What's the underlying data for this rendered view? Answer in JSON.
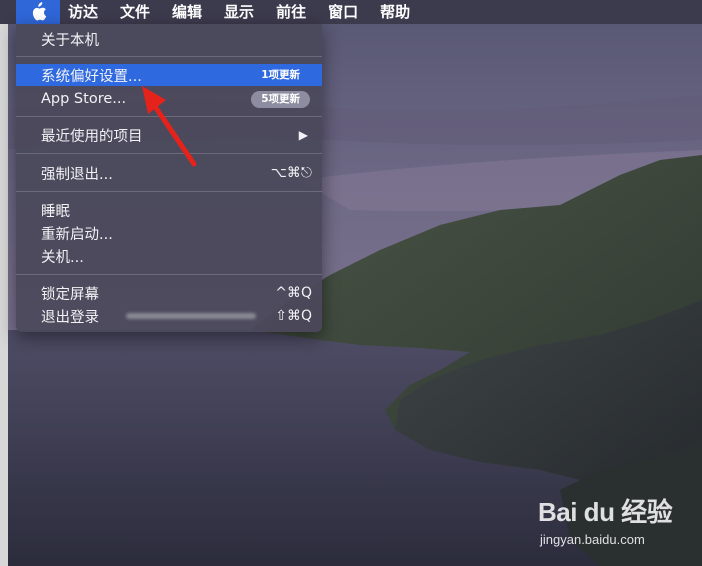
{
  "menubar": {
    "items": [
      {
        "label": "访达"
      },
      {
        "label": "文件"
      },
      {
        "label": "编辑"
      },
      {
        "label": "显示"
      },
      {
        "label": "前往"
      },
      {
        "label": "窗口"
      },
      {
        "label": "帮助"
      }
    ]
  },
  "apple_menu": {
    "icon": "apple-logo-icon",
    "items": [
      {
        "label": "关于本机"
      },
      {
        "label": "系统偏好设置...",
        "badge": "1项更新"
      },
      {
        "label": "App Store...",
        "badge": "5项更新"
      },
      {
        "label": "最近使用的项目",
        "submenu_glyph": "▶"
      },
      {
        "label": "强制退出...",
        "shortcut": "⌥⌘⎋"
      },
      {
        "label": "睡眠"
      },
      {
        "label": "重新启动..."
      },
      {
        "label": "关机..."
      },
      {
        "label": "锁定屏幕",
        "shortcut": "^⌘Q"
      },
      {
        "label": "退出登录",
        "shortcut": "⇧⌘Q"
      }
    ],
    "highlight_color": "#2f69e0"
  },
  "annotation": {
    "arrow_color": "#e5231b"
  },
  "watermark": {
    "logo": "Bai du 经验",
    "url": "jingyan.baidu.com"
  }
}
